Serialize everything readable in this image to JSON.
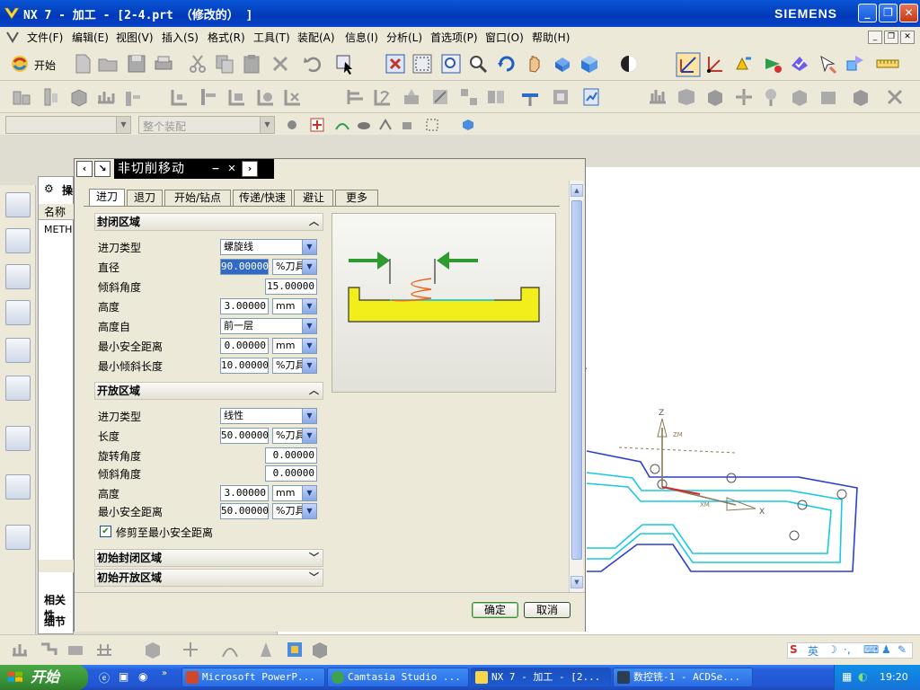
{
  "window": {
    "title": "NX 7 - 加工 - [2-4.prt （修改的） ]",
    "brand": "SIEMENS"
  },
  "menu": [
    "文件(F)",
    "编辑(E)",
    "视图(V)",
    "插入(S)",
    "格式(R)",
    "工具(T)",
    "装配(A)",
    "信息(I)",
    "分析(L)",
    "首选项(P)",
    "窗口(O)",
    "帮助(H)"
  ],
  "toolbar": {
    "start_label": "开始",
    "assembly_combo": "整个装配"
  },
  "nav": {
    "col_name": "名称",
    "row_method": "METH",
    "prefix": "操",
    "related": "相关性",
    "detail": "细节"
  },
  "dialog": {
    "title": "非切削移动",
    "tabs": [
      "进刀",
      "退刀",
      "开始/钻点",
      "传递/快速",
      "避让",
      "更多"
    ],
    "closed_area": {
      "header": "封闭区域",
      "rows": [
        {
          "label": "进刀类型",
          "value": "螺旋线"
        },
        {
          "label": "直径",
          "value": "90.00000",
          "unit": "%刀具"
        },
        {
          "label": "倾斜角度",
          "value": "15.00000"
        },
        {
          "label": "高度",
          "value": "3.00000",
          "unit": "mm"
        },
        {
          "label": "高度自",
          "value": "前一层"
        },
        {
          "label": "最小安全距离",
          "value": "0.00000",
          "unit": "mm"
        },
        {
          "label": "最小倾斜长度",
          "value": "10.00000",
          "unit": "%刀具"
        }
      ]
    },
    "open_area": {
      "header": "开放区域",
      "rows": [
        {
          "label": "进刀类型",
          "value": "线性"
        },
        {
          "label": "长度",
          "value": "50.00000",
          "unit": "%刀具"
        },
        {
          "label": "旋转角度",
          "value": "0.00000"
        },
        {
          "label": "倾斜角度",
          "value": "0.00000"
        },
        {
          "label": "高度",
          "value": "3.00000",
          "unit": "mm"
        },
        {
          "label": "最小安全距离",
          "value": "50.00000",
          "unit": "%刀具"
        }
      ],
      "trim_check": "修剪至最小安全距离"
    },
    "init_closed": "初始封闭区域",
    "init_open": "初始开放区域",
    "ok": "确定",
    "cancel": "取消"
  },
  "viewport": {
    "axis_z": "Z",
    "axis_x": "X",
    "axis_zm": "ZM",
    "axis_xm": "XM"
  },
  "taskbar": {
    "start": "开始",
    "tasks": [
      "Microsoft PowerP...",
      "Camtasia Studio ...",
      "NX 7 - 加工 - [2...",
      "数控铣-1 - ACDSe..."
    ],
    "clock": "19:20"
  },
  "colors": {
    "title_blue": "#0a56d6",
    "part_yellow": "#f2ee1c",
    "arrow_green": "#2f9a2f",
    "helix_orange": "#e8661d",
    "path_cyan": "#18c8e4",
    "path_blue": "#2b3fd0"
  }
}
